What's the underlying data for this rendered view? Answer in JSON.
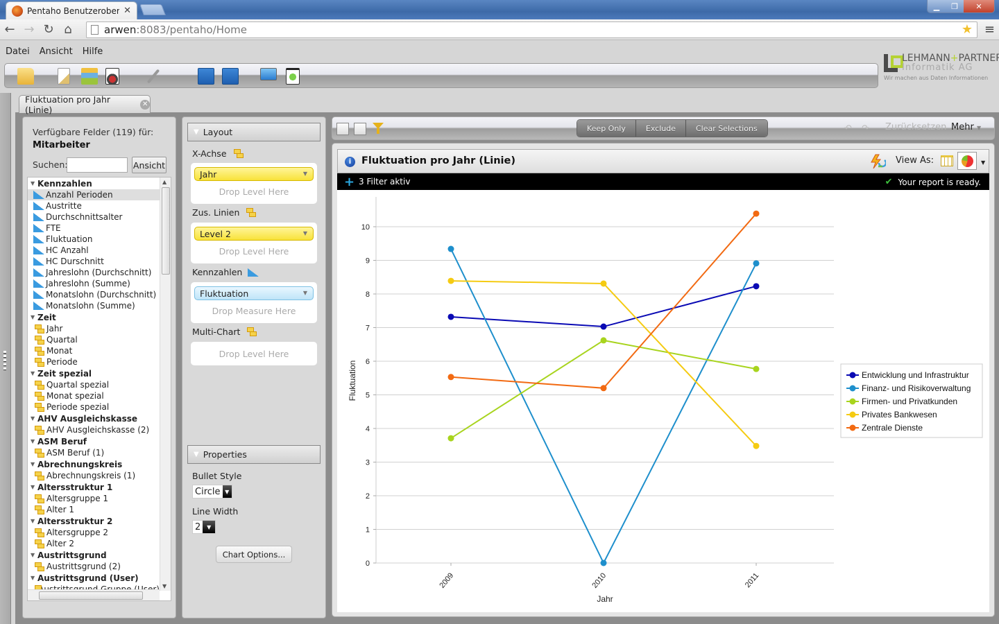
{
  "browser": {
    "tab_title": "Pentaho Benutzeroberfläc",
    "url_host": "arwen",
    "url_rest": ":8083/pentaho/Home"
  },
  "menu": [
    "Datei",
    "Ansicht",
    "Hilfe"
  ],
  "toolbar_icons": [
    "open-folder-icon",
    "new-report-icon",
    "new-analysis-icon",
    "new-dashboard-icon",
    "edit-icon",
    "save-icon",
    "save-as-icon",
    "presentation-icon",
    "run-icon"
  ],
  "logo": {
    "line1a": "LEHMANN",
    "line1b": "+",
    "line1c": "PARTNER",
    "line2": "Informatik AG",
    "tagline": "Wir machen aus Daten Informationen"
  },
  "doc_tab": {
    "label": "Fluktuation pro Jahr (Linie)"
  },
  "field_panel": {
    "available_label": "Verfügbare Felder (119) für:",
    "cube": "Mitarbeiter",
    "search_label": "Suchen:",
    "search_value": "",
    "view_button": "Ansicht",
    "groups": [
      {
        "label": "Kennzahlen",
        "type": "measure",
        "items": [
          "Anzahl Perioden",
          "Austritte",
          "Durchschnittsalter",
          "FTE",
          "Fluktuation",
          "HC Anzahl",
          "HC Durschnitt",
          "Jahreslohn (Durchschnitt)",
          "Jahreslohn (Summe)",
          "Monatslohn (Durchschnitt)",
          "Monatslohn (Summe)"
        ]
      },
      {
        "label": "Zeit",
        "type": "level",
        "items": [
          "Jahr",
          "Quartal",
          "Monat",
          "Periode"
        ]
      },
      {
        "label": "Zeit spezial",
        "type": "level",
        "items": [
          "Quartal spezial",
          "Monat spezial",
          "Periode spezial"
        ]
      },
      {
        "label": "AHV Ausgleichskasse",
        "type": "level",
        "items": [
          "AHV Ausgleichskasse (2)"
        ]
      },
      {
        "label": "ASM Beruf",
        "type": "level",
        "items": [
          "ASM Beruf (1)"
        ]
      },
      {
        "label": "Abrechnungskreis",
        "type": "level",
        "items": [
          "Abrechnungskreis (1)"
        ]
      },
      {
        "label": "Altersstruktur 1",
        "type": "level",
        "items": [
          "Altersgruppe 1",
          "Alter 1"
        ]
      },
      {
        "label": "Altersstruktur 2",
        "type": "level",
        "items": [
          "Altersgruppe 2",
          "Alter 2"
        ]
      },
      {
        "label": "Austrittsgrund",
        "type": "level",
        "items": [
          "Austrittsgrund (2)"
        ]
      },
      {
        "label": "Austrittsgrund (User)",
        "type": "level",
        "items": [
          "Austrittsgrund Gruppe (User)"
        ]
      }
    ],
    "selected_item": "Anzahl Perioden"
  },
  "layout_panel": {
    "header": "Layout",
    "x_axis_label": "X-Achse",
    "x_axis_value": "Jahr",
    "x_axis_hint": "Drop Level Here",
    "lines_label": "Zus. Linien",
    "lines_value": "Level 2",
    "lines_hint": "Drop Level Here",
    "measures_label": "Kennzahlen",
    "measures_value": "Fluktuation",
    "measures_hint": "Drop Measure Here",
    "multichart_label": "Multi-Chart",
    "multichart_hint": "Drop Level Here"
  },
  "properties_panel": {
    "header": "Properties",
    "bullet_style_label": "Bullet Style",
    "bullet_style_value": "Circle",
    "line_width_label": "Line Width",
    "line_width_value": "2",
    "chart_options_button": "Chart Options..."
  },
  "report_toolbar": {
    "keep_only": "Keep Only",
    "exclude": "Exclude",
    "clear_selections": "Clear Selections",
    "reset": "Zurücksetzen",
    "more": "Mehr"
  },
  "report": {
    "title": "Fluktuation pro Jahr (Linie)",
    "view_as_label": "View As:",
    "filter_text": "3 Filter aktiv",
    "status_text": "Your report is ready."
  },
  "chart_data": {
    "type": "line",
    "title": "",
    "xlabel": "Jahr",
    "ylabel": "Fluktuation",
    "categories": [
      "2009",
      "2010",
      "2011"
    ],
    "ylim": [
      0,
      10.8
    ],
    "yticks": [
      0,
      1,
      2,
      3,
      4,
      5,
      6,
      7,
      8,
      9,
      10
    ],
    "grid": true,
    "legend_position": "right",
    "series": [
      {
        "name": "Entwicklung und Infrastruktur",
        "color": "#0a0ab4",
        "values": [
          7.32,
          7.03,
          8.23
        ]
      },
      {
        "name": "Finanz- und Risikoverwaltung",
        "color": "#1e8fcc",
        "values": [
          9.34,
          0,
          8.91
        ]
      },
      {
        "name": "Firmen- und Privatkunden",
        "color": "#a8d41e",
        "values": [
          3.71,
          6.62,
          5.77
        ]
      },
      {
        "name": "Privates Bankwesen",
        "color": "#f5cb12",
        "values": [
          8.39,
          8.31,
          3.48
        ]
      },
      {
        "name": "Zentrale Dienste",
        "color": "#f26a12",
        "values": [
          5.53,
          5.2,
          10.39
        ]
      }
    ]
  }
}
